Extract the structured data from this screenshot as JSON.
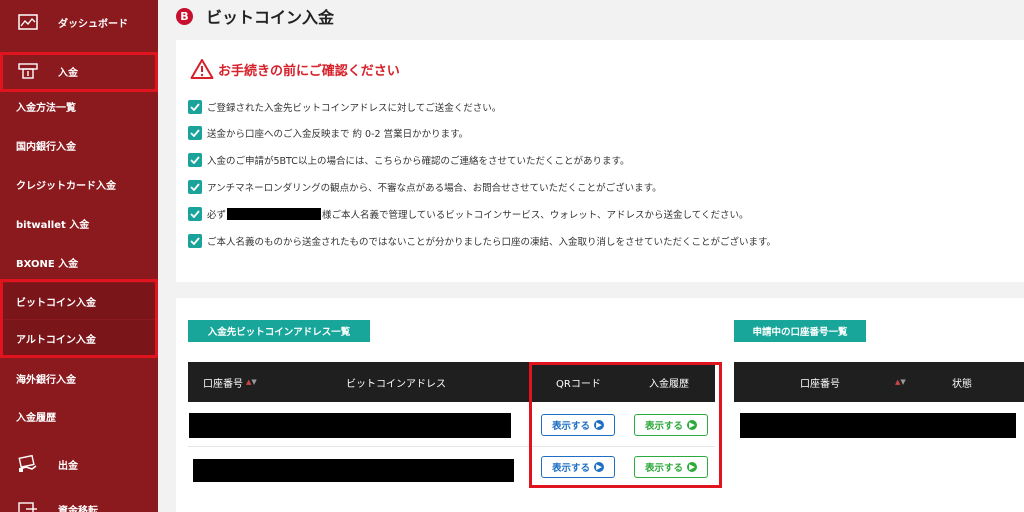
{
  "sidebar": {
    "items": [
      {
        "label": "ダッシュボード",
        "icon": "dashboard-icon"
      },
      {
        "label": "入金",
        "icon": "deposit-icon"
      },
      {
        "label": "入金方法一覧"
      },
      {
        "label": "国内銀行入金"
      },
      {
        "label": "クレジットカード入金"
      },
      {
        "label": "bitwallet 入金"
      },
      {
        "label": "BXONE 入金"
      },
      {
        "label": "ビットコイン入金"
      },
      {
        "label": "アルトコイン入金"
      },
      {
        "label": "海外銀行入金"
      },
      {
        "label": "入金履歴"
      },
      {
        "label": "出金",
        "icon": "withdraw-icon"
      },
      {
        "label": "資金移転",
        "icon": "transfer-icon"
      }
    ]
  },
  "page": {
    "title": "ビットコイン入金",
    "badge": "B"
  },
  "notice": {
    "title": "お手続きの前にご確認ください",
    "items": [
      "ご登録された入金先ビットコインアドレスに対してご送金ください。",
      "送金から口座へのご入金反映まで 約 0-2 営業日かかります。",
      "入金のご申請が5BTC以上の場合には、こちらから確認のご連絡をさせていただくことがあります。",
      "アンチマネーロンダリングの観点から、不審な点がある場合、お問合せさせていただくことがございます。",
      "必ず",
      "ご本人名義のものから送金されたものではないことが分かりましたら口座の凍結、入金取り消しをさせていただくことがございます。"
    ],
    "item5_suffix": "様ご本人名義で管理しているビットコインサービス、ウォレット、アドレスから送金してください。"
  },
  "addresses": {
    "label": "入金先ビットコインアドレス一覧",
    "headers": {
      "account": "口座番号",
      "address": "ビットコインアドレス",
      "qr": "QRコード",
      "history": "入金履歴"
    },
    "rows": [
      {
        "qr_btn": "表示する",
        "history_btn": "表示する"
      },
      {
        "qr_btn": "表示する",
        "history_btn": "表示する"
      }
    ]
  },
  "pending": {
    "label": "申請中の口座番号一覧",
    "headers": {
      "account": "口座番号",
      "status": "状態"
    }
  },
  "colors": {
    "sidebar": "#8b1a1f",
    "highlight": "#e0141e",
    "teal": "#18a69a",
    "button_blue": "#1e6fc4",
    "button_green": "#2eaa3c"
  }
}
